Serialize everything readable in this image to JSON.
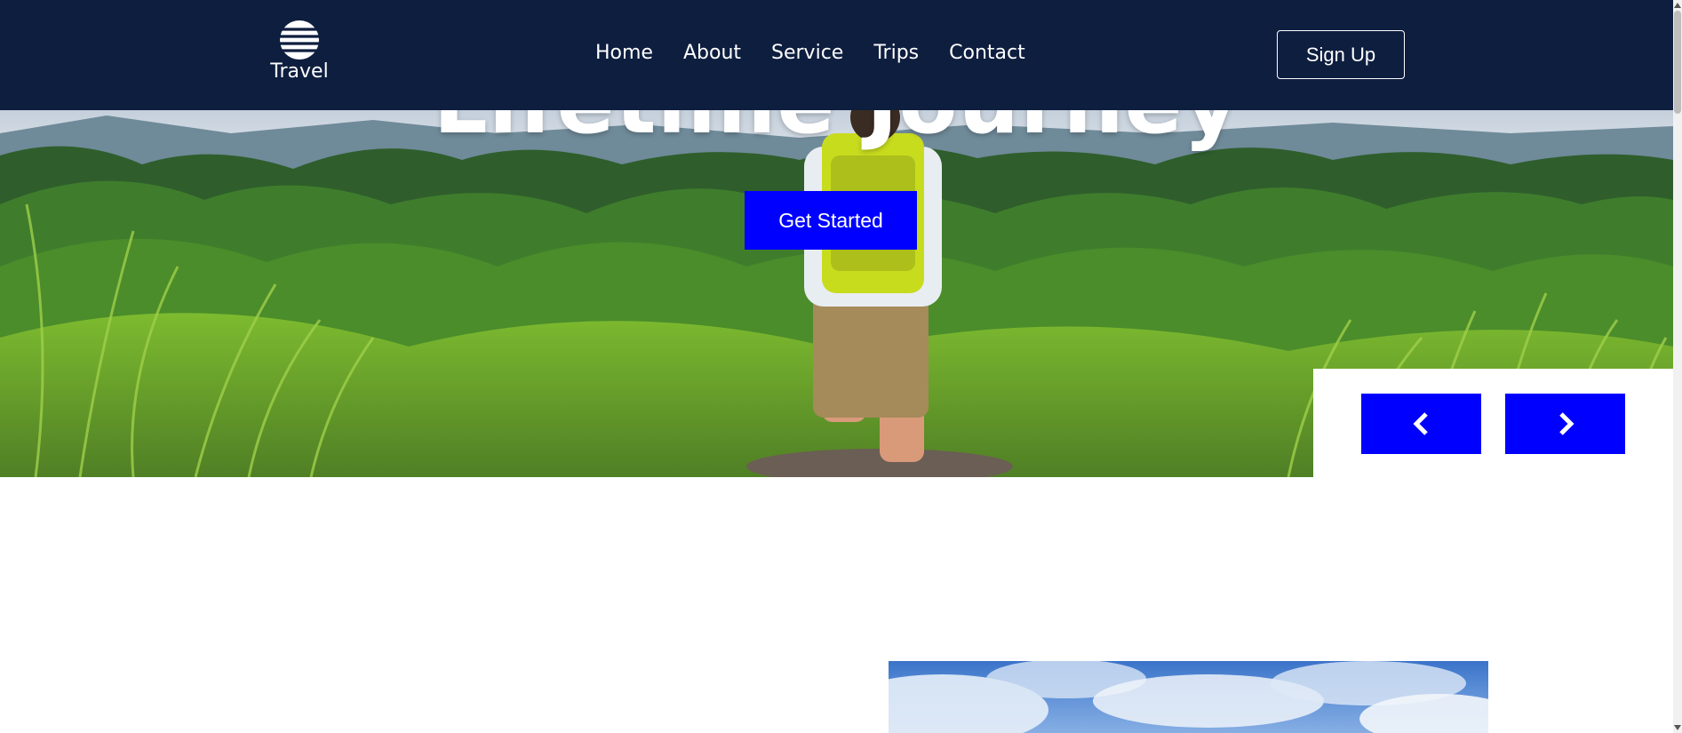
{
  "brand": {
    "name": "Travel",
    "icon": "globe-icon"
  },
  "nav": {
    "items": [
      "Home",
      "About",
      "Service",
      "Trips",
      "Contact"
    ],
    "signup_label": "Sign Up"
  },
  "hero": {
    "title": "Lifetime Journey",
    "cta_label": "Get Started"
  },
  "slider": {
    "prev_icon": "chevron-left-icon",
    "next_icon": "chevron-right-icon"
  },
  "colors": {
    "navbar_bg": "#0e1e3f",
    "accent": "#0000ff",
    "text_light": "#ffffff"
  }
}
